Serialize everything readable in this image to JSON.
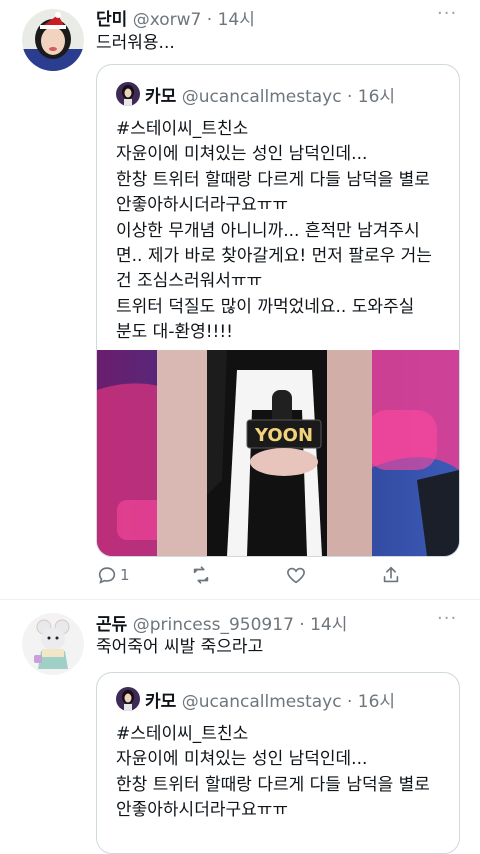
{
  "tweets": [
    {
      "name": "단미",
      "handle": "@xorw7",
      "dot": "·",
      "time": "14시",
      "text": "드러워용...",
      "quote": {
        "name": "카모",
        "handle": "@ucancallmestayc",
        "dot": "·",
        "time": "16시",
        "lines": [
          "#스테이씨_트친소",
          "자윤이에 미쳐있는 성인 남덕인데...",
          "한창 트위터 할때랑 다르게 다들 남덕을 별로",
          "안좋아하시더라구요ㅠㅠ",
          "이상한 무개념 아니니까... 흔적만 남겨주시",
          "면.. 제가 바로 찾아갈게요! 먼저 팔로우 거는",
          "건 조심스러워서ㅠㅠ",
          "트위터 덕질도 많이 까먹었네요.. 도와주실",
          "분도 대-환영!!!!"
        ],
        "image_caption": "YOON"
      },
      "reply_count": "1",
      "more": "···"
    },
    {
      "name": "곤듀",
      "handle": "@princess_950917",
      "dot": "·",
      "time": "14시",
      "text": "죽어죽어 씨발 죽으라고",
      "quote": {
        "name": "카모",
        "handle": "@ucancallmestayc",
        "dot": "·",
        "time": "16시",
        "lines": [
          "#스테이씨_트친소",
          "자윤이에 미쳐있는 성인 남덕인데...",
          "한창 트위터 할때랑 다르게 다들 남덕을 별로",
          "안좋아하시더라구요ㅠㅠ"
        ]
      },
      "more": "···"
    }
  ],
  "colors": {
    "text": "#0f1419",
    "secondary": "#6e767d",
    "border": "#cfd9de"
  }
}
